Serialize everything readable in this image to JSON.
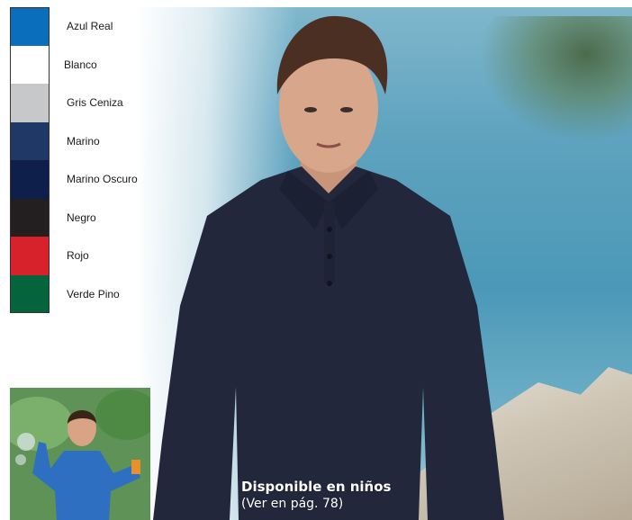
{
  "swatches": [
    {
      "label": "Azul Real",
      "color": "#0a6ebd"
    },
    {
      "label": "Blanco",
      "color": "#ffffff"
    },
    {
      "label": "Gris Ceniza",
      "color": "#c6c8ca"
    },
    {
      "label": "Marino",
      "color": "#1f3866"
    },
    {
      "label": "Marino Oscuro",
      "color": "#0f1f4c"
    },
    {
      "label": "Negro",
      "color": "#231f20"
    },
    {
      "label": "Rojo",
      "color": "#d7222c"
    },
    {
      "label": "Verde Pino",
      "color": "#05643c"
    }
  ],
  "caption": {
    "title": "Disponible en niños",
    "page_ref": "(Ver en pág. 78)"
  },
  "colors": {
    "shirt": "#22273b",
    "caption_text": "#ffffff"
  }
}
